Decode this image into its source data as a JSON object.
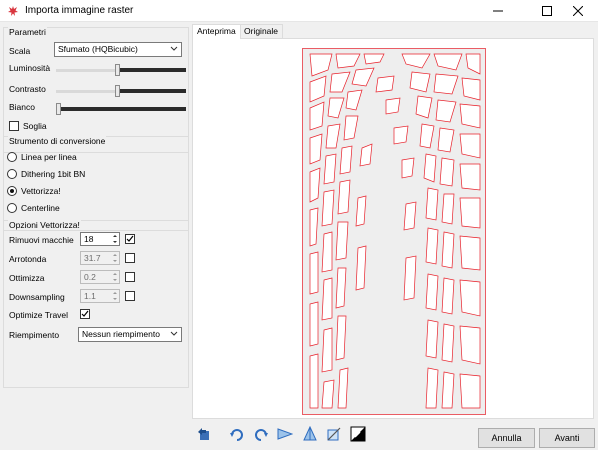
{
  "window": {
    "title": "Importa immagine raster"
  },
  "parametri": {
    "group_label": "Parametri",
    "scala_label": "Scala",
    "scala_value": "Sfumato (HQBicubic)",
    "luminosita_label": "Luminosità",
    "luminosita_level": 0.47,
    "contrasto_label": "Contrasto",
    "contrasto_level": 0.47,
    "bianco_label": "Bianco",
    "bianco_level": 0.0,
    "soglia_label": "Soglia",
    "soglia_checked": false
  },
  "strumento": {
    "group_label": "Strumento di conversione",
    "options": [
      {
        "label": "Linea per linea",
        "selected": false
      },
      {
        "label": "Dithering 1bit BN",
        "selected": false
      },
      {
        "label": "Vettorizza!",
        "selected": true
      },
      {
        "label": "Centerline",
        "selected": false
      }
    ]
  },
  "opzioni": {
    "group_label": "Opzioni Vettorizza!",
    "rimuovi_label": "Rimuovi macchie",
    "rimuovi_value": "18",
    "rimuovi_checked": true,
    "arrotonda_label": "Arrotonda",
    "arrotonda_value": "31.7",
    "arrotonda_checked": false,
    "ottimizza_label": "Ottimizza",
    "ottimizza_value": "0.2",
    "ottimizza_checked": false,
    "downsampling_label": "Downsampling",
    "downsampling_value": "1.1",
    "downsampling_checked": false,
    "optimize_travel_label": "Optimize Travel",
    "optimize_travel_checked": true,
    "riempimento_label": "Riempimento",
    "riempimento_value": "Nessun riempimento"
  },
  "tabs": [
    {
      "label": "Anteprima",
      "active": true
    },
    {
      "label": "Originale",
      "active": false
    }
  ],
  "toolbar": {
    "icons": [
      "reset-icon",
      "rotate-left-icon",
      "rotate-right-icon",
      "flip-horizontal-icon",
      "flip-vertical-icon",
      "crop-icon",
      "invert-icon"
    ]
  },
  "buttons": {
    "cancel": "Annulla",
    "next": "Avanti"
  },
  "colors": {
    "vector_stroke": "#e8202a",
    "canvas_bg": "#eeeeee",
    "accent_dark": "#2b2b2b"
  }
}
